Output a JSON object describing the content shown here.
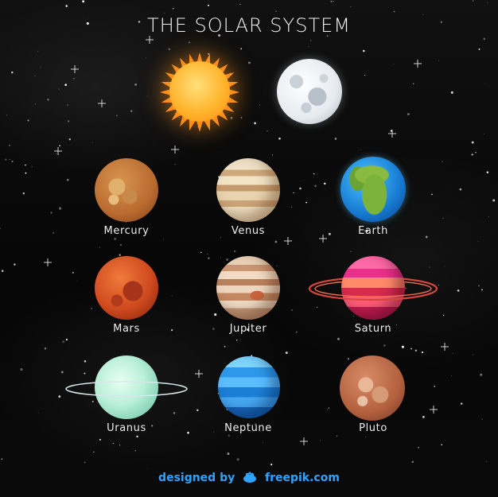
{
  "title": "THE SOLAR SYSTEM",
  "bodies": {
    "sun": {
      "color": "#ffa51f"
    },
    "moon": {
      "color": "#e6ebf0"
    }
  },
  "planets": [
    {
      "name": "Mercury",
      "color": "#b86a2f"
    },
    {
      "name": "Venus",
      "color": "#e9d4b0"
    },
    {
      "name": "Earth",
      "color": "#1679d0"
    },
    {
      "name": "Mars",
      "color": "#cf4a1e"
    },
    {
      "name": "Jupiter",
      "color": "#c99572"
    },
    {
      "name": "Saturn",
      "color": "#e9308a"
    },
    {
      "name": "Uranus",
      "color": "#b9efd8"
    },
    {
      "name": "Neptune",
      "color": "#2d98ea"
    },
    {
      "name": "Pluto",
      "color": "#b2603e"
    }
  ],
  "footer": {
    "part1": "designed by",
    "logo_icon": "freepik-logo-icon",
    "part2": "freepik.com",
    "color": "#2ea3ff"
  }
}
